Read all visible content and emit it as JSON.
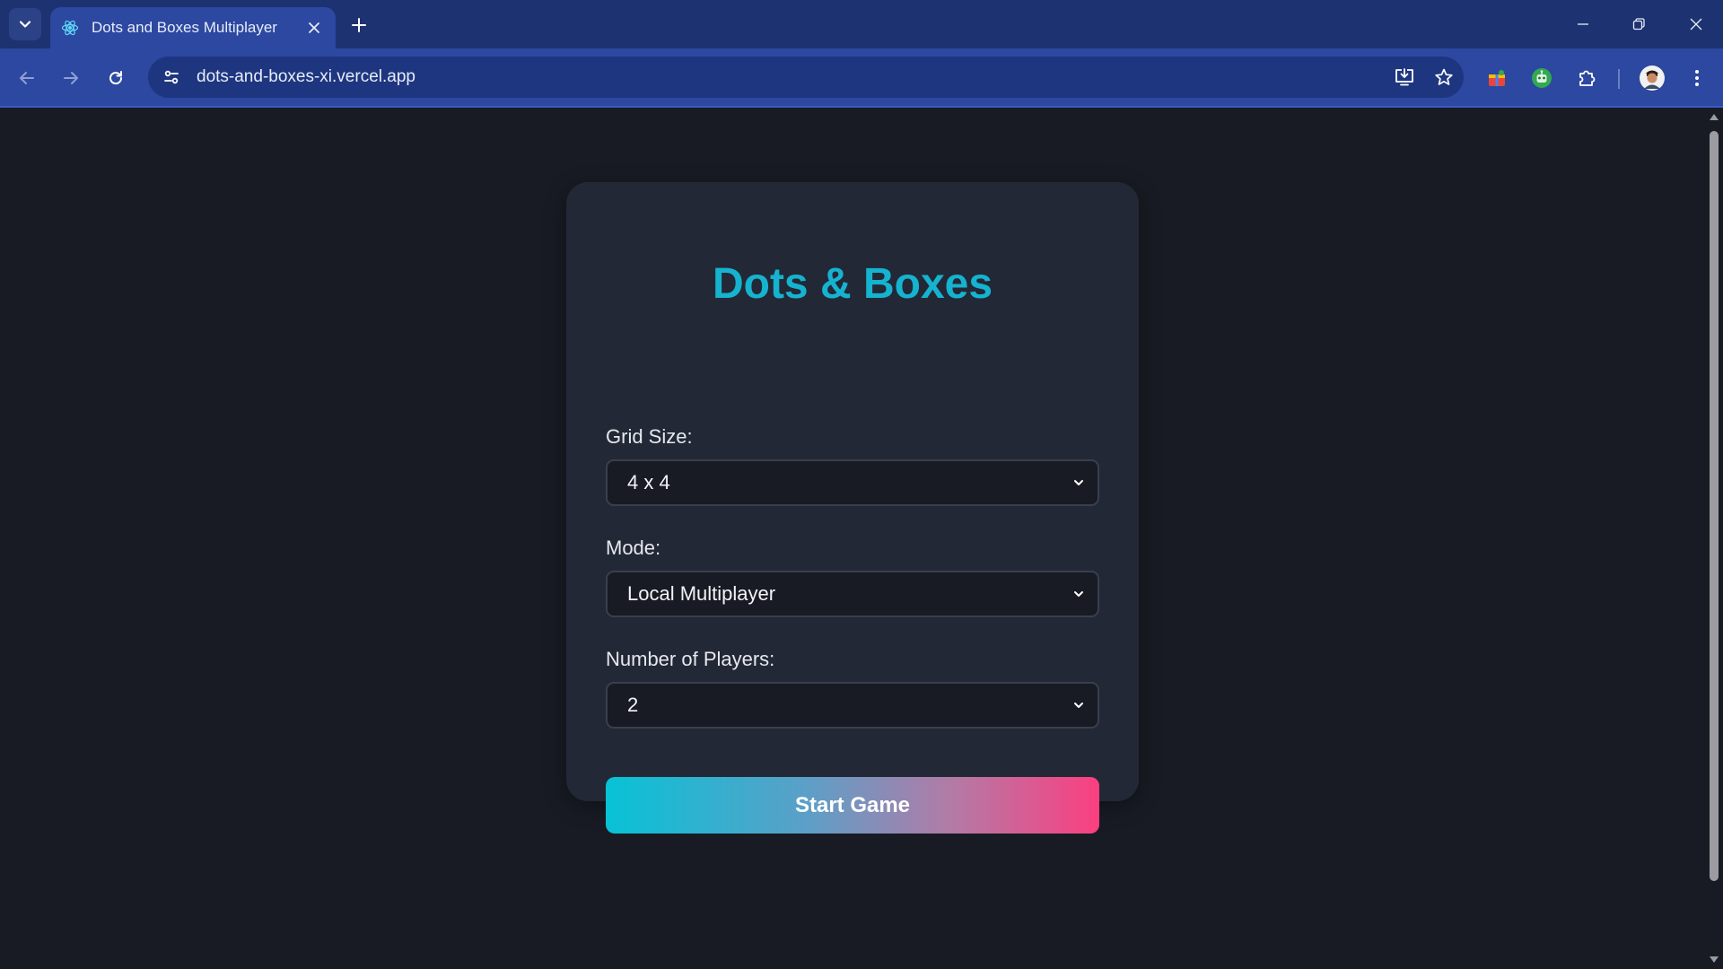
{
  "browser": {
    "tab": {
      "title": "Dots and Boxes Multiplayer"
    },
    "address_bar": {
      "url": "dots-and-boxes-xi.vercel.app"
    }
  },
  "page": {
    "title": "Dots & Boxes",
    "fields": {
      "grid_size": {
        "label": "Grid Size:",
        "value": "4 x 4"
      },
      "mode": {
        "label": "Mode:",
        "value": "Local Multiplayer"
      },
      "players": {
        "label": "Number of Players:",
        "value": "2"
      }
    },
    "start_button": "Start Game"
  },
  "colors": {
    "title_accent": "#15b3cf",
    "button_gradient_start": "#07c2d6",
    "button_gradient_end": "#fb3f80",
    "browser_frame": "#1d3270",
    "page_background": "#181b23",
    "card_background": "#232836"
  },
  "icons": {
    "tab_search": "chevron-down-icon",
    "favicon": "react-atom-icon",
    "tab_close": "close-icon",
    "new_tab": "plus-icon",
    "back": "arrow-left-icon",
    "forward": "arrow-right-icon",
    "reload": "reload-icon",
    "site_info": "tune-icon",
    "install": "install-app-icon",
    "bookmark": "star-icon",
    "extensions": "puzzle-icon",
    "menu": "kebab-menu-icon"
  }
}
